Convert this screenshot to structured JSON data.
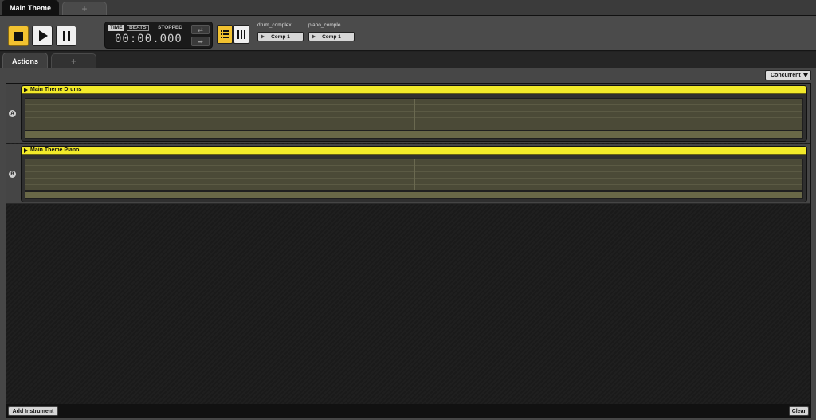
{
  "doc_tabs": {
    "active": "Main Theme",
    "add": "+"
  },
  "transport": {
    "time_label": "TIME",
    "beats_label": "BEATS",
    "status": "STOPPED",
    "clock": "00:00.000",
    "accent": "#f2c230"
  },
  "compositions": [
    {
      "name": "drum_complex...",
      "button": "Comp 1"
    },
    {
      "name": "piano_comple...",
      "button": "Comp 1"
    }
  ],
  "section_tabs": {
    "active": "Actions",
    "add": "+"
  },
  "mode": {
    "selected": "Concurrent"
  },
  "lanes": [
    {
      "letter": "A",
      "clip_title": "Main Theme Drums",
      "clip_color": "#f2ea2a"
    },
    {
      "letter": "B",
      "clip_title": "Main Theme Piano",
      "clip_color": "#f2ea2a"
    }
  ],
  "footer": {
    "add_instrument": "Add Instrument",
    "clear": "Clear"
  }
}
